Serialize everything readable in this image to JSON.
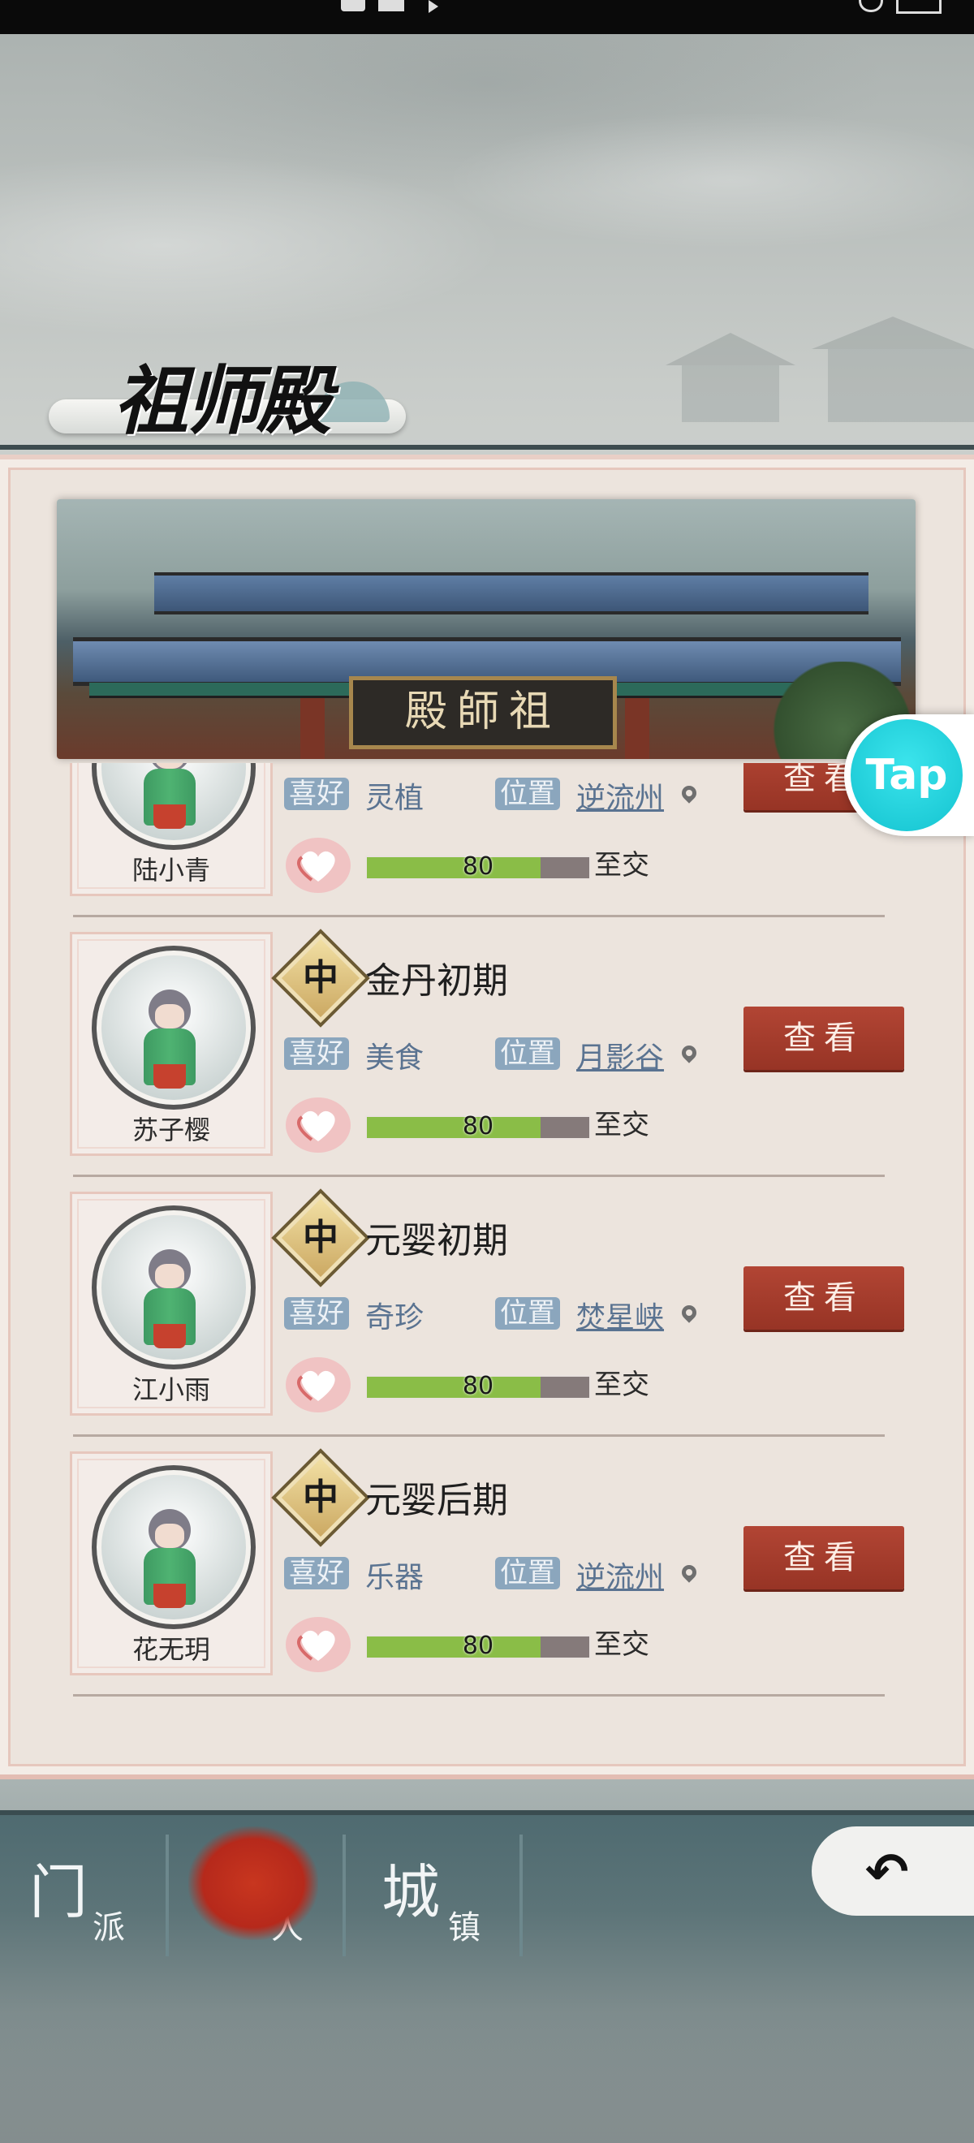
{
  "title": "祖师殿",
  "banner": {
    "plaque": "殿師祖"
  },
  "list": {
    "rows": [
      {
        "name": "陆小青",
        "realm_badge": "",
        "realm": "",
        "like_label": "喜好",
        "like": "灵植",
        "pos_label": "位置",
        "pos": "逆流州",
        "favor": "80",
        "favor_pct": 78,
        "relation": "至交",
        "view_label": "查看"
      },
      {
        "name": "苏子樱",
        "realm_badge": "中",
        "realm": "金丹初期",
        "like_label": "喜好",
        "like": "美食",
        "pos_label": "位置",
        "pos": "月影谷",
        "favor": "80",
        "favor_pct": 78,
        "relation": "至交",
        "view_label": "查看"
      },
      {
        "name": "江小雨",
        "realm_badge": "中",
        "realm": "元婴初期",
        "like_label": "喜好",
        "like": "奇珍",
        "pos_label": "位置",
        "pos": "焚星峡",
        "favor": "80",
        "favor_pct": 78,
        "relation": "至交",
        "view_label": "查看"
      },
      {
        "name": "花无玥",
        "realm_badge": "中",
        "realm": "元婴后期",
        "like_label": "喜好",
        "like": "乐器",
        "pos_label": "位置",
        "pos": "逆流州",
        "favor": "80",
        "favor_pct": 78,
        "relation": "至交",
        "view_label": "查看"
      }
    ]
  },
  "tap": {
    "label": "Tap"
  },
  "nav": {
    "items": [
      {
        "big": "门",
        "small": "派"
      },
      {
        "big": "个",
        "small": "人",
        "active": true
      },
      {
        "big": "城",
        "small": "镇"
      }
    ],
    "back_icon": "back-arrow-icon"
  },
  "colors": {
    "view_button": "#a63c2d",
    "favor_fill": "#8abd47",
    "tag": "#8ba6bd",
    "tap": "#1ec9d4"
  }
}
